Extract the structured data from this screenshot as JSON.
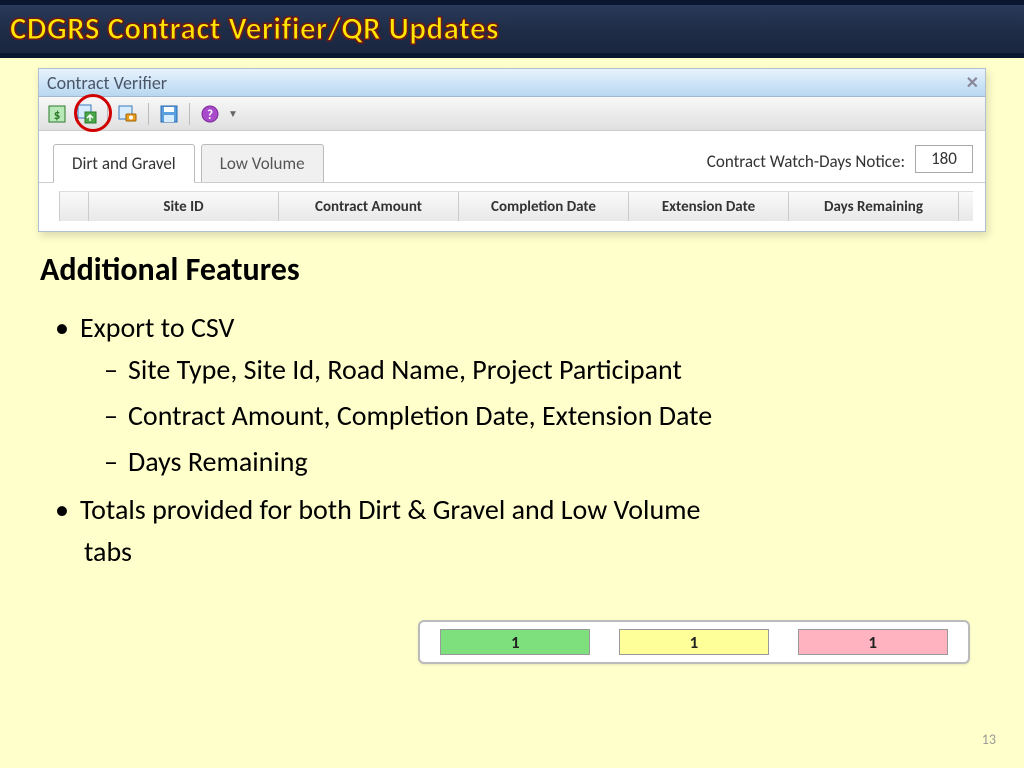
{
  "header": {
    "title": "CDGRS Contract Verifier/QR Updates"
  },
  "window": {
    "title": "Contract Verifier",
    "tabs": [
      "Dirt and Gravel",
      "Low Volume"
    ],
    "watch_label": "Contract Watch-Days Notice:",
    "watch_value": "180",
    "columns": [
      "Site ID",
      "Contract Amount",
      "Completion Date",
      "Extension Date",
      "Days Remaining"
    ]
  },
  "body": {
    "heading": "Additional Features",
    "b1": "Export to CSV",
    "s1": "Site Type, Site Id, Road Name, Project Participant",
    "s2": "Contract Amount, Completion Date, Extension Date",
    "s3": "Days Remaining",
    "b2a": "Totals provided for both Dirt & Gravel and Low Volume",
    "b2b": "tabs"
  },
  "totals": {
    "green": "1",
    "yellow": "1",
    "pink": "1"
  },
  "page": "13"
}
